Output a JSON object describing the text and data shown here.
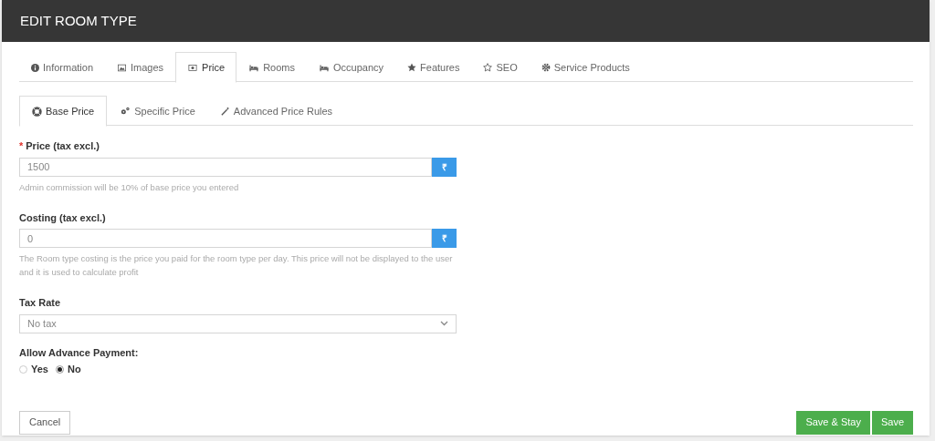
{
  "header": {
    "title": "EDIT ROOM TYPE"
  },
  "tabs": [
    {
      "label": "Information",
      "selected": false
    },
    {
      "label": "Images",
      "selected": false
    },
    {
      "label": "Price",
      "selected": true
    },
    {
      "label": "Rooms",
      "selected": false
    },
    {
      "label": "Occupancy",
      "selected": false
    },
    {
      "label": "Features",
      "selected": false
    },
    {
      "label": "SEO",
      "selected": false
    },
    {
      "label": "Service Products",
      "selected": false
    }
  ],
  "subtabs": [
    {
      "label": "Base Price",
      "selected": true
    },
    {
      "label": "Specific Price",
      "selected": false
    },
    {
      "label": "Advanced Price Rules",
      "selected": false
    }
  ],
  "fields": [
    {
      "kind": "money",
      "required_mark": "*",
      "label": "Price (tax excl.)",
      "value": "1500",
      "addon": "₹",
      "help": "Admin commission will be 10% of base price you entered"
    },
    {
      "kind": "money",
      "label": "Costing (tax excl.)",
      "value": "0",
      "addon": "₹",
      "help": "The Room type costing is the price you paid for the room type per day. This price will not be displayed to the user and it is used to calculate profit"
    },
    {
      "kind": "select",
      "label": "Tax Rate",
      "value": "No tax"
    },
    {
      "kind": "radio",
      "label": "Allow Advance Payment:",
      "options": [
        {
          "label": "Yes",
          "selected": false
        },
        {
          "label": "No",
          "selected": true
        }
      ]
    }
  ],
  "buttons": {
    "cancel": "Cancel",
    "save_stay": "Save & Stay",
    "save": "Save"
  }
}
